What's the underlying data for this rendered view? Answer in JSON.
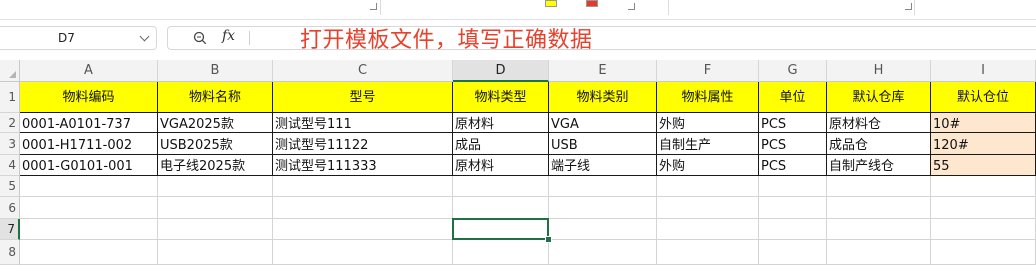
{
  "name_box": {
    "value": "D7"
  },
  "formula_bar": {
    "fx_label": "fx",
    "content": ""
  },
  "annotation": "打开模板文件，填写正确数据",
  "columns": [
    "A",
    "B",
    "C",
    "D",
    "E",
    "F",
    "G",
    "H",
    "I"
  ],
  "selected_column": "D",
  "rows": [
    "1",
    "2",
    "3",
    "4",
    "5",
    "6",
    "7",
    "8"
  ],
  "selected_row": "7",
  "active_cell": "D7",
  "header_row": [
    "物料编码",
    "物料名称",
    "型号",
    "物料类型",
    "物料类别",
    "物料属性",
    "单位",
    "默认仓库",
    "默认仓位"
  ],
  "data_rows": [
    [
      "0001-A0101-737",
      "VGA2025款",
      "测试型号111",
      "原材料",
      "VGA",
      "外购",
      "PCS",
      "原材料仓",
      "10#"
    ],
    [
      "0001-H1711-002",
      "USB2025款",
      "测试型号11122",
      "成品",
      "USB",
      "自制生产",
      "PCS",
      "成品仓",
      "120#"
    ],
    [
      "0001-G0101-001",
      "电子线2025款",
      "测试型号111333",
      "原材料",
      "端子线",
      "外购",
      "PCS",
      "自制产线仓",
      "55"
    ]
  ],
  "colors": {
    "header_fill": "#ffff00",
    "location_fill": "#fde7cf",
    "selection": "#1e7145",
    "annotation": "#e8412c"
  }
}
